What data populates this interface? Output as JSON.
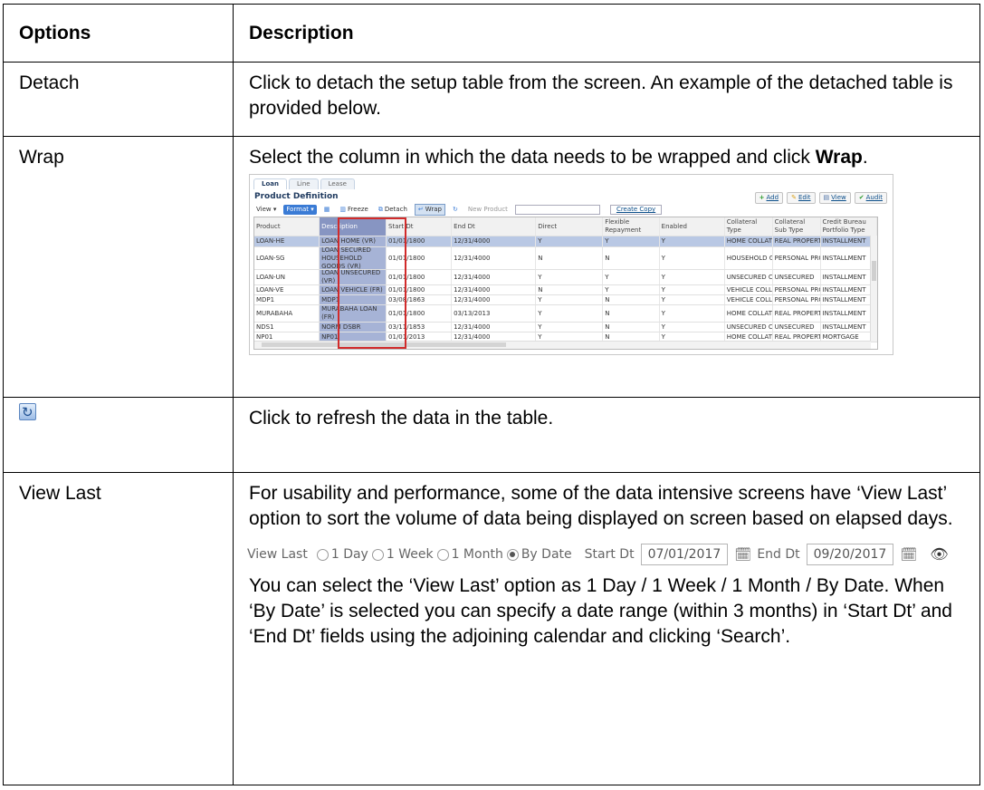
{
  "table": {
    "header_options": "Options",
    "header_description": "Description"
  },
  "rows": {
    "detach": {
      "option": "Detach",
      "desc": "Click to detach the setup table from the screen. An example of the detached table is provided below."
    },
    "wrap": {
      "option": "Wrap",
      "desc_pre": "Select the column in which the data needs to be wrapped and click ",
      "desc_bold": "Wrap",
      "desc_post": "."
    },
    "refresh": {
      "icon": "refresh-icon",
      "desc": "Click to refresh the data in the table."
    },
    "viewlast": {
      "option": "View Last",
      "desc1": "For usability and performance, some of the data intensive screens have ‘View Last’ option to sort the volume of data being displayed on screen based on elapsed days.",
      "desc2": "You can select the ‘View Last’ option as 1 Day / 1 Week / 1 Month / By Date. When ‘By Date’ is selected you can specify a date range (within 3 months) in ‘Start Dt’ and ‘End Dt’ fields using the adjoining calendar and clicking ‘Search’."
    }
  },
  "screenshot": {
    "tabs": [
      "Loan",
      "Line",
      "Lease"
    ],
    "title": "Product Definition",
    "buttons": {
      "add": "Add",
      "edit": "Edit",
      "view": "View",
      "audit": "Audit"
    },
    "toolbar": {
      "view": "View ▾",
      "format": "Format ▾",
      "freeze": "Freeze",
      "detach": "Detach",
      "wrap": "Wrap",
      "new_product": "New Product",
      "create_copy": "Create Copy"
    },
    "columns": [
      "Product",
      "Description",
      "Start Dt",
      "End Dt",
      "Direct",
      "Flexible Repayment",
      "Enabled",
      "Collateral Type",
      "Collateral Sub Type",
      "Credit Bureau Portfolio Type"
    ],
    "rows": [
      [
        "LOAN-HE",
        "LOAN HOME (VR)",
        "01/01/1800",
        "12/31/4000",
        "Y",
        "Y",
        "Y",
        "HOME COLLATERAL",
        "REAL PROPERTY HOM",
        "INSTALLMENT"
      ],
      [
        "LOAN-SG",
        "LOAN SECURED HOUSEHOLD GOODS (VR)",
        "01/01/1800",
        "12/31/4000",
        "N",
        "N",
        "Y",
        "HOUSEHOLD GOODS",
        "PERSONAL PROPERT",
        "INSTALLMENT"
      ],
      [
        "LOAN-UN",
        "LOAN UNSECURED (VR)",
        "01/01/1800",
        "12/31/4000",
        "Y",
        "Y",
        "Y",
        "UNSECURED COLLATI",
        "UNSECURED",
        "INSTALLMENT"
      ],
      [
        "LOAN-VE",
        "LOAN VEHICLE (FR)",
        "01/01/1800",
        "12/31/4000",
        "N",
        "Y",
        "Y",
        "VEHICLE COLLATERA",
        "PERSONAL PROPERT",
        "INSTALLMENT"
      ],
      [
        "MDP1",
        "MDP1",
        "03/08/1863",
        "12/31/4000",
        "Y",
        "N",
        "Y",
        "VEHICLE COLLATERA",
        "PERSONAL PROPERT",
        "INSTALLMENT"
      ],
      [
        "MURABAHA",
        "MURABAHA LOAN (FR)",
        "01/01/1800",
        "03/13/2013",
        "Y",
        "N",
        "Y",
        "HOME COLLATERAL",
        "REAL PROPERTY HOM",
        "INSTALLMENT"
      ],
      [
        "NDS1",
        "NORM DSBR",
        "03/11/1853",
        "12/31/4000",
        "Y",
        "N",
        "Y",
        "UNSECURED COLLATI",
        "UNSECURED",
        "INSTALLMENT"
      ],
      [
        "NP01",
        "NP01",
        "01/01/2013",
        "12/31/4000",
        "Y",
        "N",
        "Y",
        "HOME COLLATERAL",
        "REAL PROPERTY HOM",
        "MORTGAGE"
      ]
    ]
  },
  "viewlast_strip": {
    "label": "View Last",
    "opt1": "1 Day",
    "opt2": "1 Week",
    "opt3": "1 Month",
    "opt4": "By Date",
    "start_label": "Start Dt",
    "start_value": "07/01/2017",
    "end_label": "End Dt",
    "end_value": "09/20/2017"
  }
}
